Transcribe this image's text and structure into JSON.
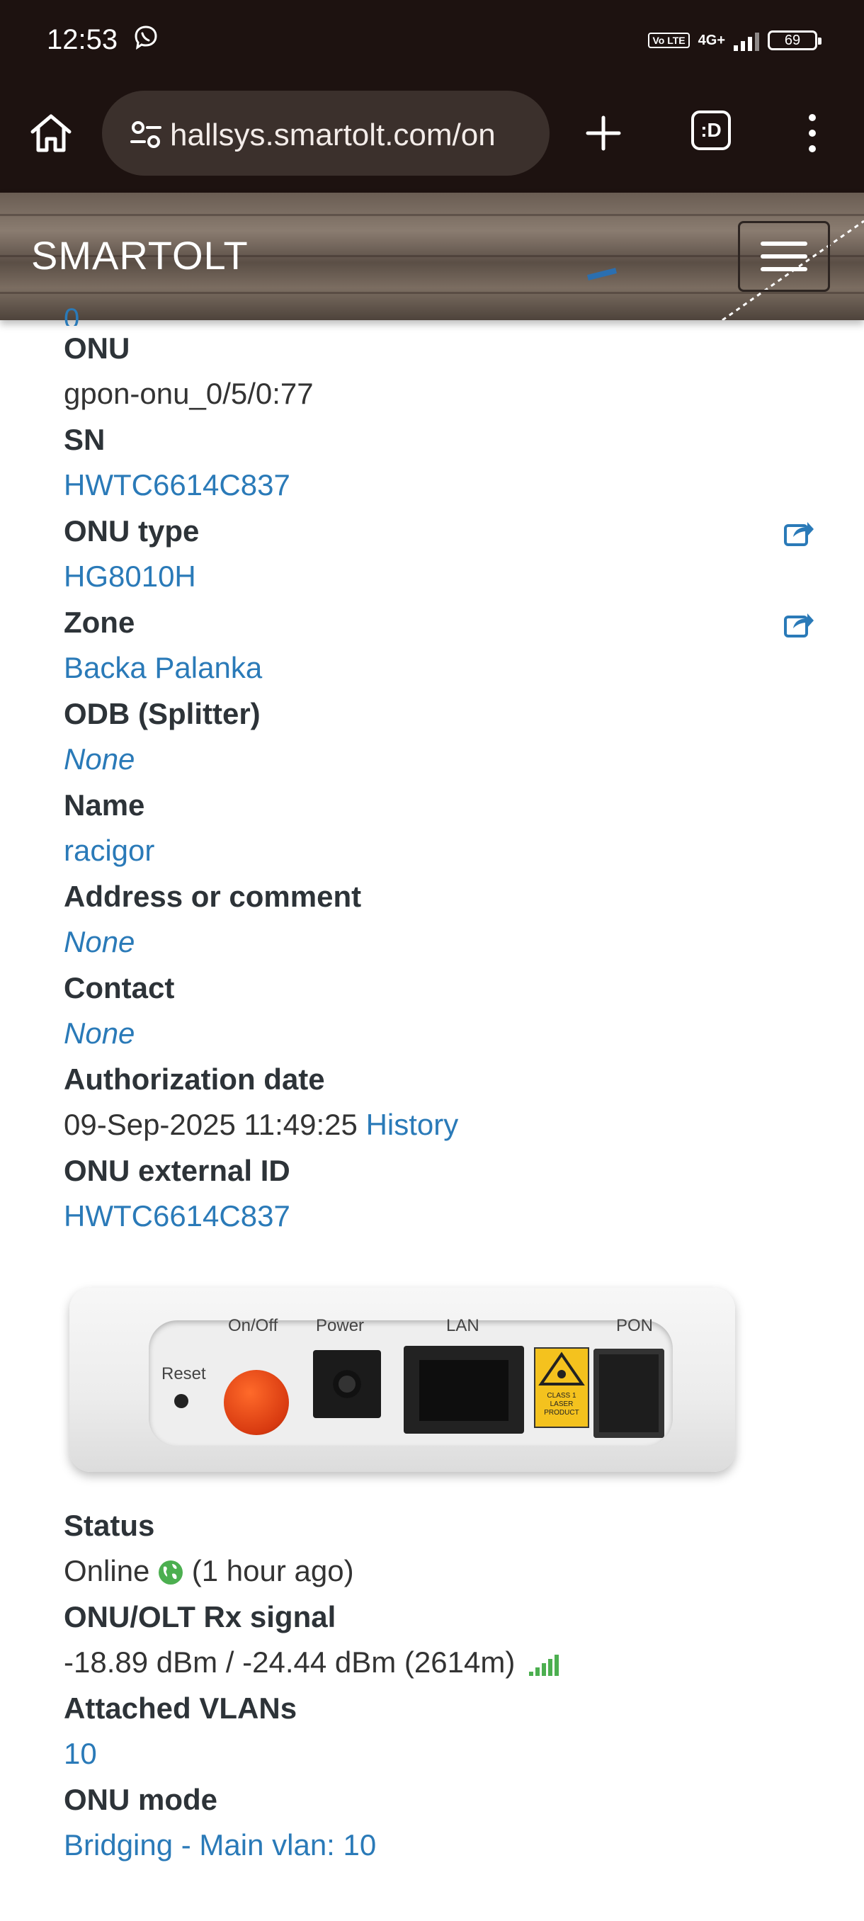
{
  "status_bar": {
    "time": "12:53",
    "volte": "Vo LTE",
    "network": "4G+",
    "battery": "69"
  },
  "browser": {
    "url": "hallsys.smartolt.com/on",
    "tabs_label": ":D"
  },
  "site": {
    "brand": "SMARTOLT"
  },
  "details": {
    "partial_value": "0",
    "fields": [
      {
        "label": "ONU",
        "value": "gpon-onu_0/5/0:77"
      },
      {
        "label": "SN",
        "value": "HWTC6614C837"
      },
      {
        "label": "ONU type",
        "value": "HG8010H"
      },
      {
        "label": "Zone",
        "value": "Backa Palanka"
      },
      {
        "label": "ODB (Splitter)",
        "value": "None"
      },
      {
        "label": "Name",
        "value": "racigor"
      },
      {
        "label": "Address or comment",
        "value": "None"
      },
      {
        "label": "Contact",
        "value": "None"
      },
      {
        "label": "Authorization date",
        "value": "09-Sep-2025 11:49:25",
        "link": "History"
      },
      {
        "label": "ONU external ID",
        "value": "HWTC6614C837"
      }
    ]
  },
  "device_image": {
    "labels": [
      "Reset",
      "On/Off",
      "Power",
      "LAN",
      "PON"
    ],
    "laser_label": "CLASS 1 LASER PRODUCT"
  },
  "status": {
    "status_label": "Status",
    "status_value": "Online",
    "status_age": "(1 hour ago)",
    "signal_label": "ONU/OLT Rx signal",
    "signal_value": "-18.89 dBm / -24.44 dBm (2614m)",
    "vlans_label": "Attached VLANs",
    "vlans_value": "10",
    "mode_label": "ONU mode",
    "mode_value": "Bridging - Main vlan: 10"
  },
  "colors": {
    "link": "#2a7ab8",
    "online": "#4caf50",
    "header_bg": "#1d1210"
  }
}
